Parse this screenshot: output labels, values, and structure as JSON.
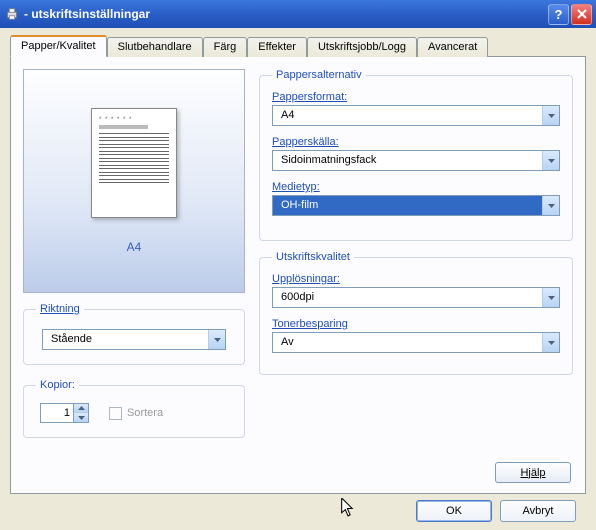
{
  "window": {
    "title": "- utskriftsinställningar"
  },
  "tabs": {
    "paper": "Papper/Kvalitet",
    "finishing": "Slutbehandlare",
    "color": "Färg",
    "effects": "Effekter",
    "joblog": "Utskriftsjobb/Logg",
    "advanced": "Avancerat"
  },
  "preview": {
    "label": "A4"
  },
  "orientation": {
    "legend": "Riktning",
    "value": "Stående"
  },
  "copies": {
    "legend": "Kopior:",
    "value": "1",
    "collate_label": "Sortera"
  },
  "paper_options": {
    "legend": "Pappersalternativ",
    "format_label": "Pappersformat:",
    "format_value": "A4",
    "source_label": "Papperskälla:",
    "source_value": "Sidoinmatningsfack",
    "media_label": "Medietyp:",
    "media_value": "OH-film"
  },
  "quality": {
    "legend": "Utskriftskvalitet",
    "res_label": "Upplösningar:",
    "res_value": "600dpi",
    "toner_label": "Tonerbesparing",
    "toner_value": "Av"
  },
  "buttons": {
    "help": "Hjälp",
    "ok": "OK",
    "cancel": "Avbryt"
  }
}
